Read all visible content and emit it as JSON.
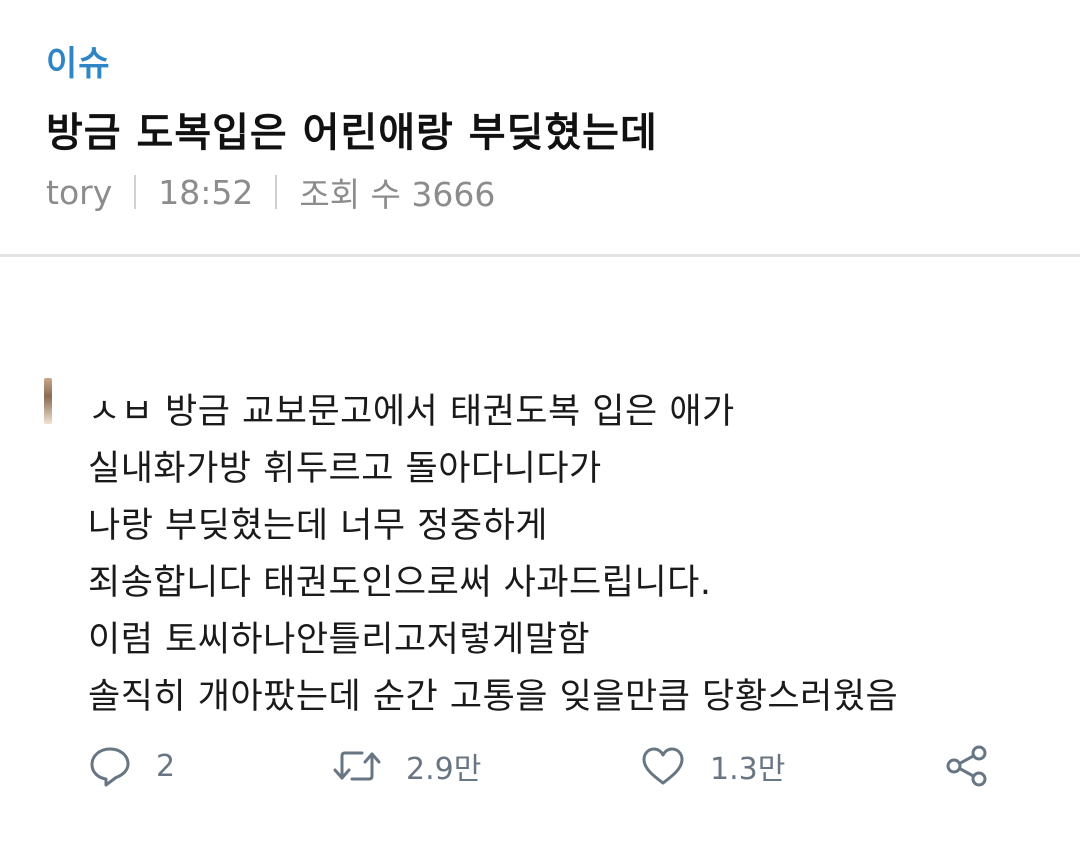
{
  "post": {
    "category": "이슈",
    "title": "방금 도복입은 어린애랑 부딪혔는데",
    "author": "tory",
    "time": "18:52",
    "views": "조회 수 3666"
  },
  "tweet": {
    "lines": [
      "ㅅㅂ 방금 교보문고에서 태권도복 입은 애가",
      "실내화가방 휘두르고 돌아다니다가",
      "나랑 부딪혔는데 너무 정중하게",
      "죄송합니다 태권도인으로써 사과드립니다.",
      "이럼 토씨하나안틀리고저렇게말함",
      "솔직히 개아팠는데 순간 고통을 잊을만큼 당황스러웠음"
    ],
    "actions": {
      "replies": "2",
      "retweets": "2.9만",
      "likes": "1.3만"
    }
  },
  "icons": {
    "reply": "reply-bubble-icon",
    "retweet": "retweet-icon",
    "like": "heart-icon",
    "share": "share-icon"
  },
  "colors": {
    "category": "#2f86c7",
    "meta": "#8c8c8c",
    "action": "#687684"
  }
}
